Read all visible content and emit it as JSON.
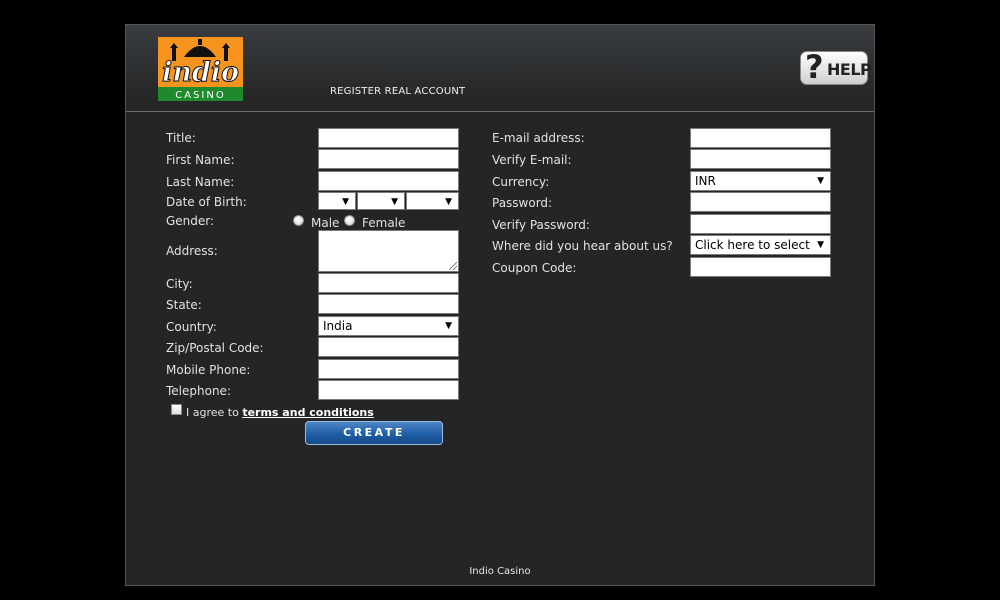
{
  "header": {
    "logo_text": "indio",
    "logo_subtext": "CASINO",
    "page_title": "REGISTER REAL ACCOUNT",
    "help_label": "HELP"
  },
  "colors": {
    "logo_orange": "#f7941d",
    "logo_green": "#1f8a2c",
    "button_blue": "#1f5ea6"
  },
  "form_left": {
    "title_label": "Title:",
    "first_name_label": "First Name:",
    "last_name_label": "Last Name:",
    "dob_label": "Date of Birth:",
    "gender_label": "Gender:",
    "gender_male": "Male",
    "gender_female": "Female",
    "address_label": "Address:",
    "city_label": "City:",
    "state_label": "State:",
    "country_label": "Country:",
    "country_value": "India",
    "zip_label": "Zip/Postal Code:",
    "mobile_label": "Mobile Phone:",
    "telephone_label": "Telephone:",
    "agree_prefix": "I agree to",
    "terms_link": "terms and conditions",
    "create_label": "CREATE"
  },
  "form_right": {
    "email_label": "E-mail address:",
    "verify_email_label": "Verify E-mail:",
    "currency_label": "Currency:",
    "currency_value": "INR",
    "password_label": "Password:",
    "verify_password_label": "Verify Password:",
    "hear_label": "Where did you hear about us?",
    "hear_value": "Click here to select",
    "coupon_label": "Coupon Code:"
  },
  "footer": {
    "text": "Indio Casino"
  }
}
